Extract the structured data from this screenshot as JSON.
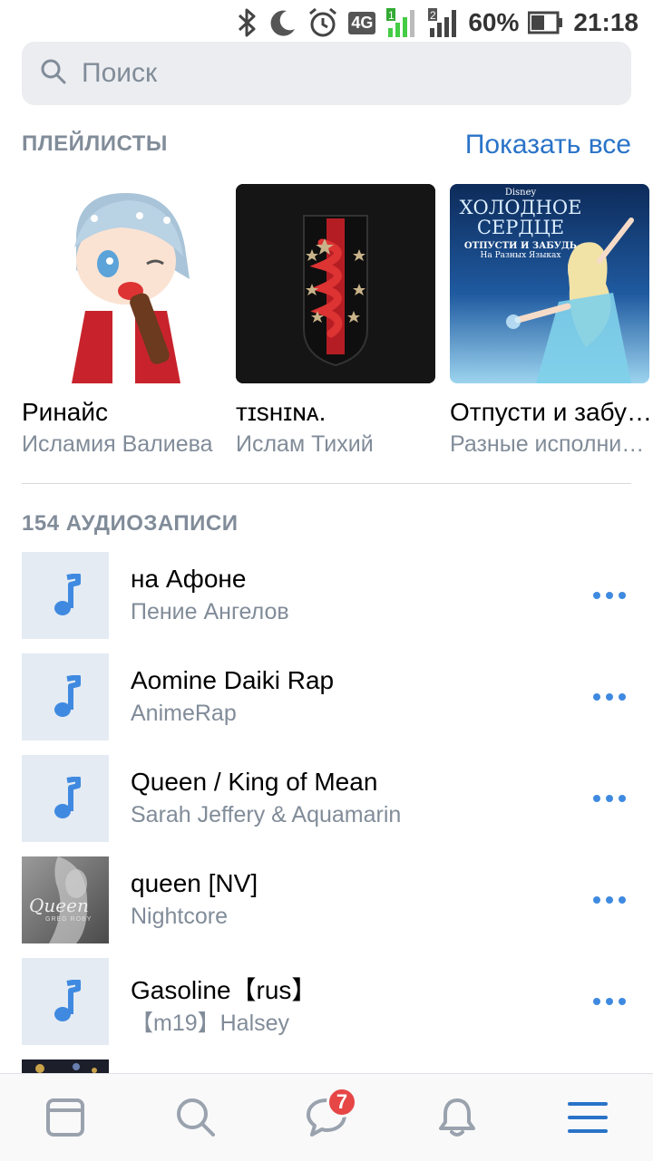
{
  "status_bar": {
    "battery": "60%",
    "time": "21:18",
    "network": "4G",
    "sim1": "1",
    "sim2": "2"
  },
  "search": {
    "placeholder": "Поиск"
  },
  "playlists": {
    "header": "ПЛЕЙЛИСТЫ",
    "show_all": "Показать все",
    "items": [
      {
        "title": "Ринайс",
        "subtitle": "Исламия Валиева"
      },
      {
        "title": "ᴛɪѕнɪɴᴀ.",
        "subtitle": "Ислам Тихий"
      },
      {
        "title": "Отпусти и забу…",
        "subtitle": "Разные исполни…",
        "cover_text": {
          "brand": "Disney",
          "title_line1": "ХОЛОДНОЕ",
          "title_line2": "СЕРДЦЕ",
          "tagline": "ОТПУСТИ И ЗАБУДЬ",
          "tagline2": "На Разных Языках"
        }
      }
    ]
  },
  "audio": {
    "header": "154 АУДИОЗАПИСИ",
    "tracks": [
      {
        "title": "на Афоне",
        "artist": "Пение Ангелов"
      },
      {
        "title": "Aomine Daiki Rap",
        "artist": "AnimeRap"
      },
      {
        "title": "Queen / King of Mean",
        "artist": "Sarah Jeffery & Aquamarin"
      },
      {
        "title": "queen [NV]",
        "artist": "Nightcore",
        "cover_text": {
          "script": "Queen",
          "small": "GREG ROBY"
        }
      },
      {
        "title": "Gasoline【rus】",
        "artist": "【m19】Halsey"
      }
    ]
  },
  "tabbar": {
    "messages_badge": "7"
  },
  "colors": {
    "accent": "#2a73c8",
    "icon_blue": "#3f8ae0",
    "secondary_text": "#818c99",
    "badge": "#e64646"
  }
}
